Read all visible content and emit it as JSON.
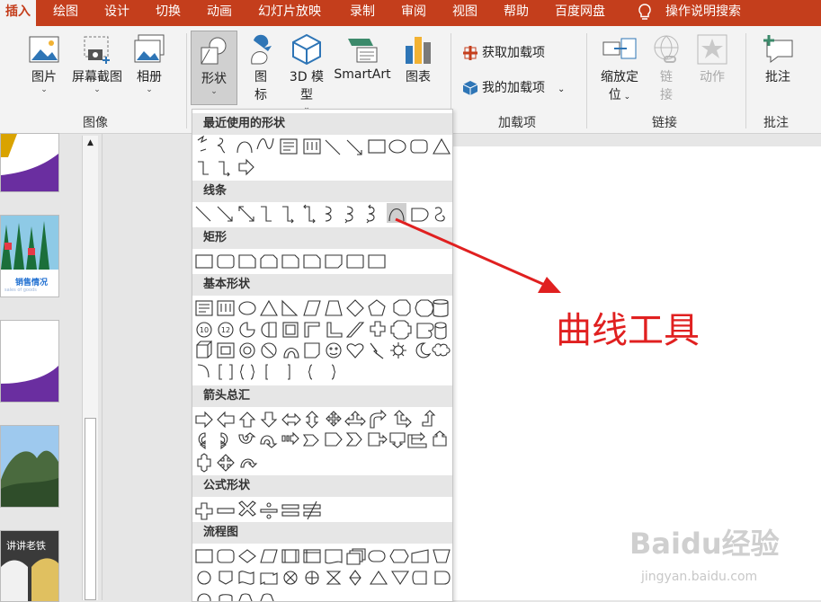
{
  "tabs": [
    "插入",
    "绘图",
    "设计",
    "切换",
    "动画",
    "幻灯片放映",
    "录制",
    "审阅",
    "视图",
    "帮助",
    "百度网盘",
    "操作说明搜索"
  ],
  "ribbon": {
    "picture": "图片",
    "screenshot": "屏幕截图",
    "album": "相册",
    "shapes": "形状",
    "icon_1": "图",
    "icon_2": "标",
    "model_1": "3D 模",
    "model_2": "型",
    "smartart": "SmartArt",
    "chart": "图表",
    "get_addins": "获取加载项",
    "my_addins": "我的加载项",
    "zoom_1": "缩放定",
    "zoom_2": "位",
    "link_1": "链",
    "link_2": "接",
    "action": "动作",
    "comment": "批注",
    "group_images": "图像",
    "group_addins": "加载项",
    "group_links": "链接",
    "group_comments": "批注"
  },
  "shapes_menu": {
    "recent": "最近使用的形状",
    "lines": "线条",
    "rect": "矩形",
    "basic": "基本形状",
    "arrows": "箭头总汇",
    "equation": "公式形状",
    "flowchart": "流程图",
    "basic_10": "10",
    "basic_12": "12"
  },
  "thumbs": {
    "sales_title": "销售情况",
    "sales_sub": "sales of goods",
    "t5_text": "讲讲老铁"
  },
  "annotation": "曲线工具",
  "watermark": {
    "logo": "Baidu经验",
    "url": "jingyan.baidu.com"
  },
  "colors": {
    "accent": "#c43e1c",
    "annotation": "#e02020",
    "slide_purple": "#6a2ea0"
  }
}
